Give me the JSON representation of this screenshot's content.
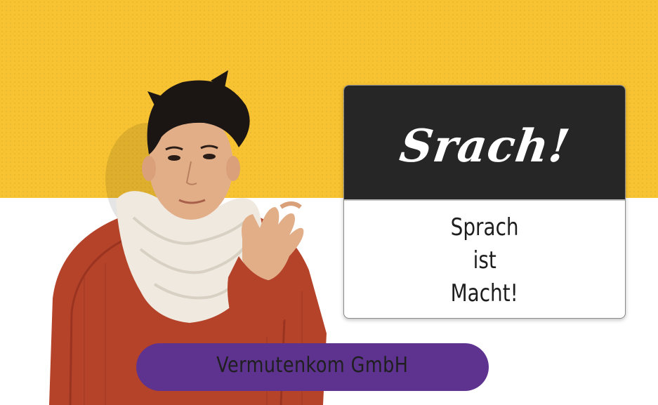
{
  "banner": {
    "colors": {
      "background_top": "#f8c332",
      "background_bottom": "#ffffff",
      "card_header": "#262626",
      "company_pill": "#5e3390"
    },
    "card": {
      "title": "Srach!",
      "slogan_lines": [
        "Sprach",
        "ist",
        "Macht!"
      ]
    },
    "company": {
      "name": "Vermutenkom GmbH"
    },
    "image": {
      "subject": "person-in-red-sweater-and-white-scarf-gesturing"
    }
  }
}
